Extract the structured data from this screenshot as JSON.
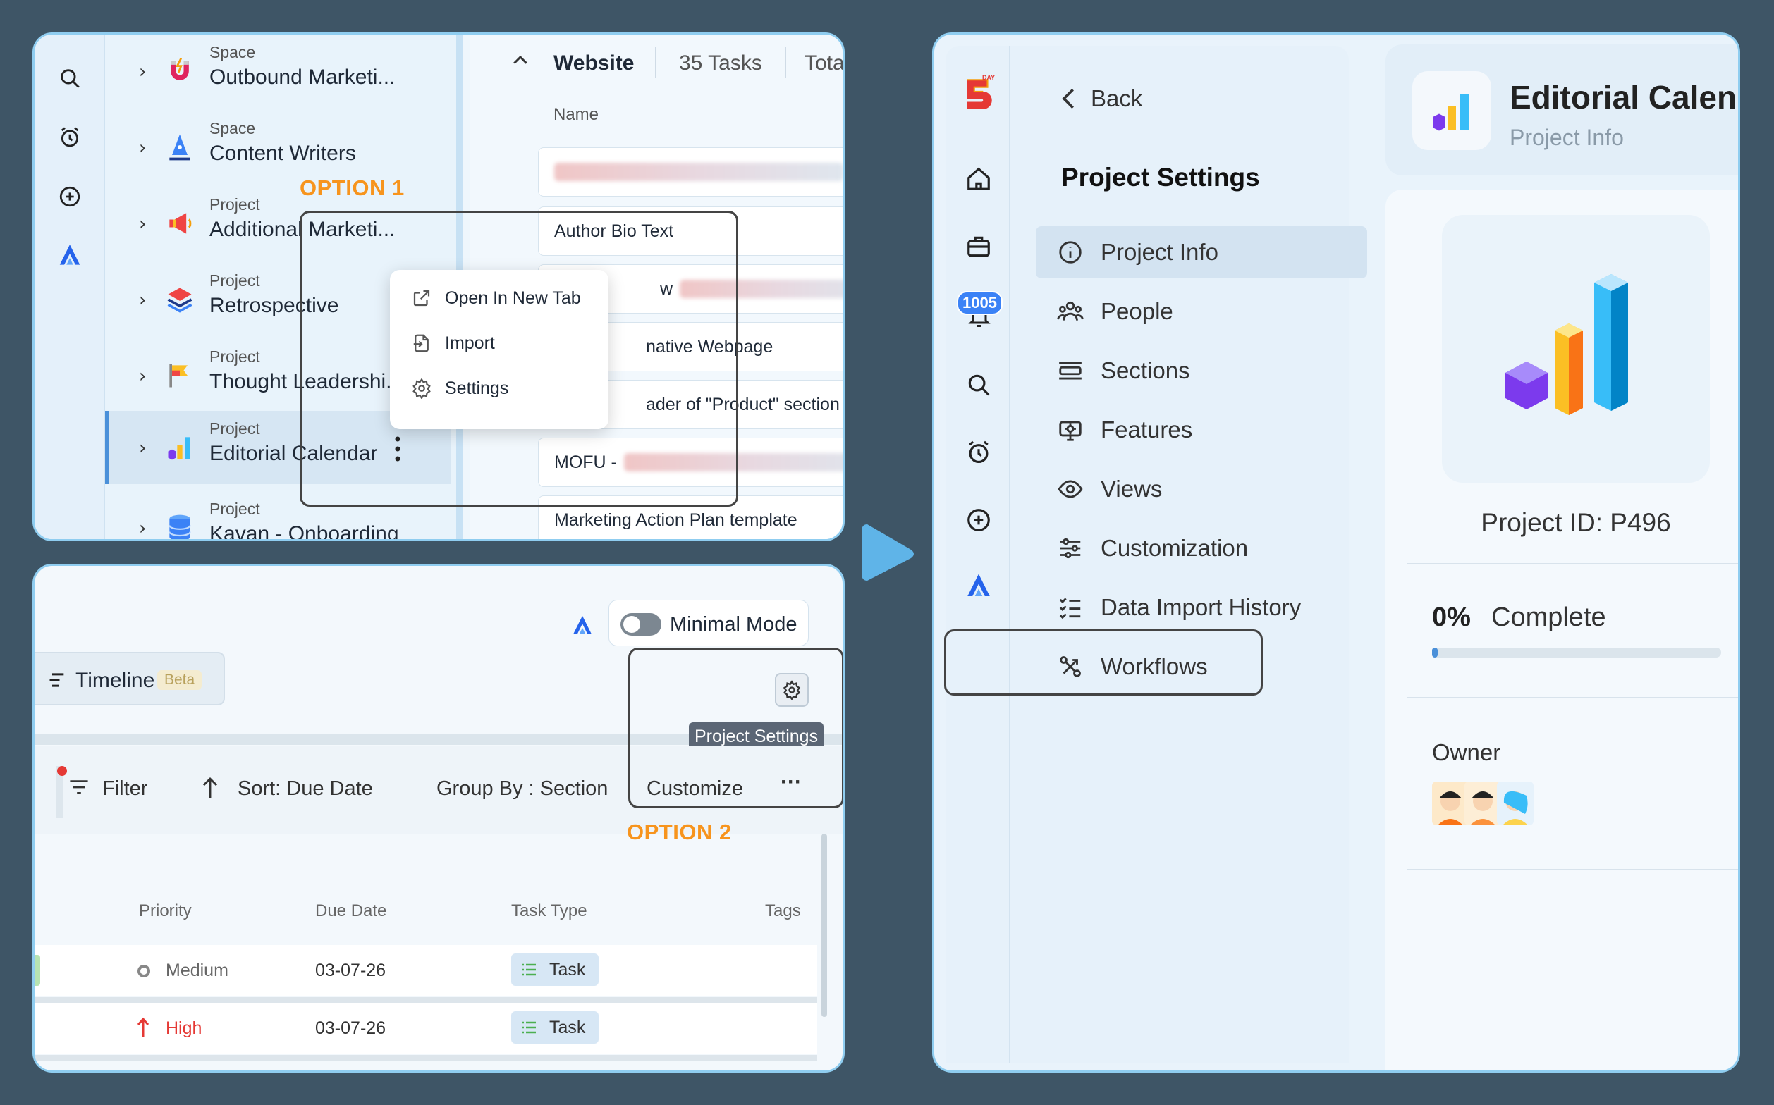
{
  "panel1": {
    "sidebar": [
      {
        "kind": "Space",
        "name": "Outbound Marketi..."
      },
      {
        "kind": "Space",
        "name": "Content Writers"
      },
      {
        "kind": "Project",
        "name": "Additional Marketi..."
      },
      {
        "kind": "Project",
        "name": "Retrospective"
      },
      {
        "kind": "Project",
        "name": "Thought Leadershi..."
      },
      {
        "kind": "Project",
        "name": "Editorial Calendar"
      },
      {
        "kind": "Project",
        "name": "Kavan - Onboarding"
      }
    ],
    "header": {
      "title": "Website",
      "tasks": "35 Tasks",
      "estimate": "Total Es"
    },
    "column_name": "Name",
    "tasks": [
      "Author Bio Text",
      "w",
      "native Webpage",
      "ader of \"Product\" section in w",
      "MOFU -",
      "Marketing Action Plan template"
    ],
    "context_menu": [
      "Open In New Tab",
      "Import",
      "Settings"
    ],
    "option_label": "OPTION 1"
  },
  "panel2": {
    "minimal_mode": "Minimal Mode",
    "view_tab": "Timeline",
    "beta_badge": "Beta",
    "tooltip": "Project Settings",
    "toolbar": {
      "filter": "Filter",
      "sort": "Sort: Due Date",
      "group": "Group By : Section",
      "customize": "Customize",
      "more": "···"
    },
    "option_label": "OPTION 2",
    "columns": [
      "Priority",
      "Due Date",
      "Task Type",
      "Tags"
    ],
    "rows": [
      {
        "priority": "Medium",
        "due": "03-07-26",
        "type": "Task"
      },
      {
        "priority": "High",
        "due": "03-07-26",
        "type": "Task"
      }
    ]
  },
  "panel3": {
    "notification_count": "1005",
    "back": "Back",
    "settings_title": "Project Settings",
    "nav": [
      "Project Info",
      "People",
      "Sections",
      "Features",
      "Views",
      "Customization",
      "Data Import History",
      "Workflows"
    ],
    "project_title": "Editorial Calend",
    "project_subtitle": "Project Info",
    "project_id": "Project ID: P496",
    "progress_pct": "0%",
    "progress_label": "Complete",
    "progress_value": 0,
    "owner_label": "Owner",
    "logo_text": "DAY"
  },
  "colors": {
    "background": "#3e5566",
    "accent": "#f7941d",
    "brand_blue": "#2563eb",
    "high_priority": "#e53935"
  }
}
